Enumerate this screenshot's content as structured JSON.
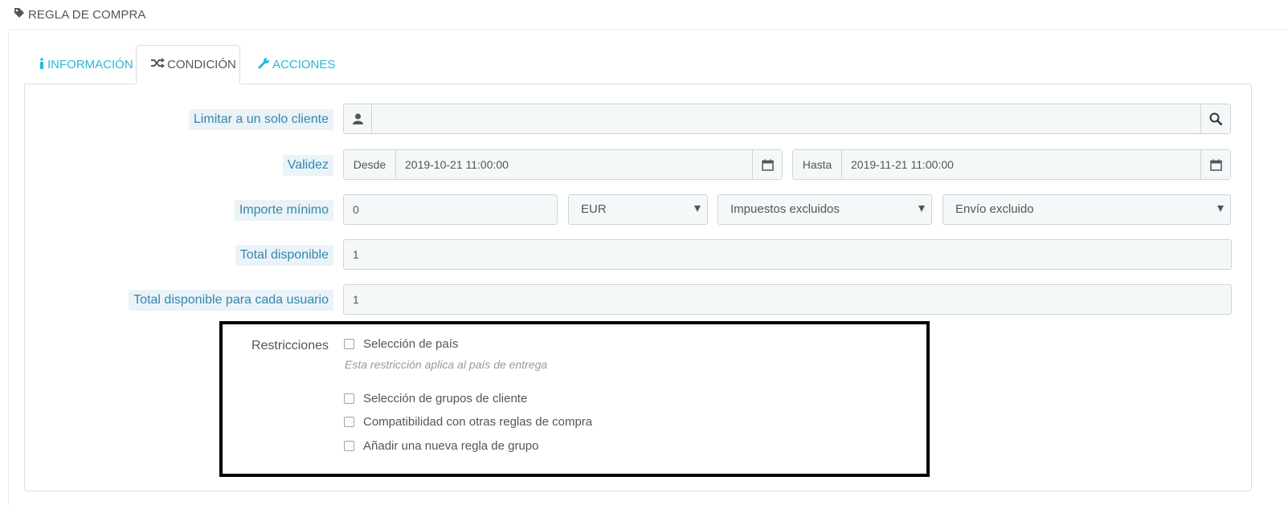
{
  "header": {
    "title": "REGLA DE COMPRA",
    "icon": "tag-icon"
  },
  "tabs": [
    {
      "label": "INFORMACIÓN",
      "icon": "info-icon",
      "active": false
    },
    {
      "label": "CONDICIÓN",
      "icon": "random-icon",
      "active": true
    },
    {
      "label": "ACCIONES",
      "icon": "wrench-icon",
      "active": false
    }
  ],
  "form": {
    "customer": {
      "label": "Limitar a un solo cliente",
      "value": "",
      "icons": [
        "user-icon",
        "search-icon"
      ]
    },
    "validity": {
      "label": "Validez",
      "from_label": "Desde",
      "from_value": "2019-10-21 11:00:00",
      "to_label": "Hasta",
      "to_value": "2019-11-21 11:00:00",
      "icon": "calendar-icon"
    },
    "minimum_amount": {
      "label": "Importe mínimo",
      "value": "0",
      "currency": "EUR",
      "tax": "Impuestos excluidos",
      "shipping": "Envío excluido"
    },
    "total_available": {
      "label": "Total disponible",
      "value": "1"
    },
    "total_per_user": {
      "label": "Total disponible para cada usuario",
      "value": "1"
    },
    "restrictions": {
      "label": "Restricciones",
      "help": "Esta restricción aplica al país de entrega",
      "items": [
        {
          "label": "Selección de país",
          "checked": false
        },
        {
          "label": "Selección de grupos de cliente",
          "checked": false
        },
        {
          "label": "Compatibilidad con otras reglas de compra",
          "checked": false
        },
        {
          "label": "Añadir una nueva regla de grupo",
          "checked": false
        }
      ]
    }
  }
}
